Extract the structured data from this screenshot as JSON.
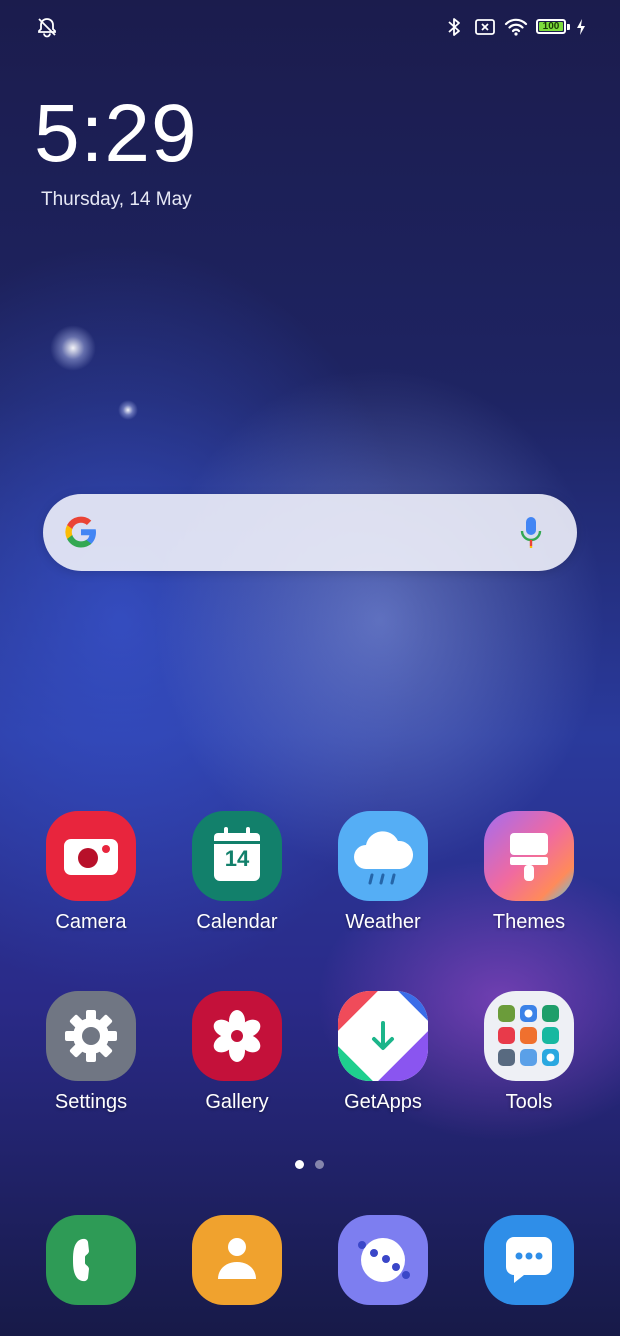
{
  "status_bar": {
    "icons": [
      "ringer-off-icon",
      "bluetooth-icon",
      "no-sim-icon",
      "wifi-icon",
      "battery-icon",
      "charging-icon"
    ],
    "battery_level": "100",
    "battery_color": "#7ddc3c"
  },
  "lockclock": {
    "time": "5:29",
    "date": "Thursday, 14 May"
  },
  "search": {
    "logo_icon": "google-g-icon",
    "mic_icon": "microphone-icon"
  },
  "apps": [
    {
      "label": "Camera",
      "icon": "camera-icon",
      "color": "#e8253d"
    },
    {
      "label": "Calendar",
      "icon": "calendar-icon",
      "color": "#12806b",
      "day": "14"
    },
    {
      "label": "Weather",
      "icon": "weather-icon",
      "color": "#55aef5"
    },
    {
      "label": "Themes",
      "icon": "themes-brush-icon",
      "color": "#e86aa6"
    },
    {
      "label": "Settings",
      "icon": "gear-icon",
      "color": "#707683"
    },
    {
      "label": "Gallery",
      "icon": "flower-icon",
      "color": "#c4113a"
    },
    {
      "label": "GetApps",
      "icon": "getapps-icon",
      "color": "#f04b5a"
    },
    {
      "label": "Tools",
      "icon": "folder-icon",
      "color": "#eef0f5"
    }
  ],
  "page_indicator": {
    "pages": 2,
    "current": 1
  },
  "dock": [
    {
      "icon": "phone-icon",
      "color": "#2e9b56"
    },
    {
      "icon": "contacts-icon",
      "color": "#f0a22e"
    },
    {
      "icon": "browser-icon",
      "color": "#7d7ef0"
    },
    {
      "icon": "messages-icon",
      "color": "#2f8ee8"
    }
  ]
}
